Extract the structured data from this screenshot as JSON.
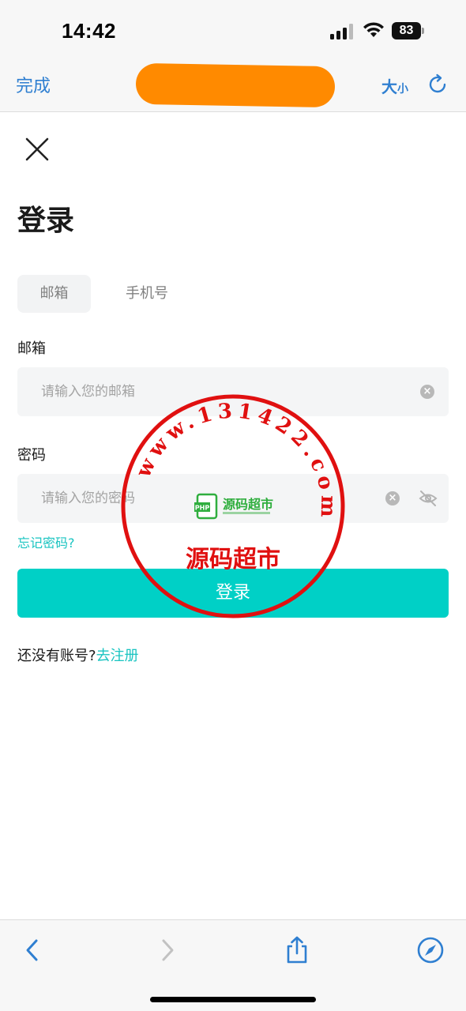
{
  "status": {
    "time": "14:42",
    "battery": "83"
  },
  "nav": {
    "done_label": "完成",
    "font_size_big": "大",
    "font_size_small": "小"
  },
  "page": {
    "title": "登录"
  },
  "tabs": [
    {
      "label": "邮箱",
      "active": true
    },
    {
      "label": "手机号",
      "active": false
    }
  ],
  "form": {
    "email_label": "邮箱",
    "email_placeholder": "请输入您的邮箱",
    "email_value": "",
    "password_label": "密码",
    "password_placeholder": "请输入您的密码",
    "password_value": "",
    "forgot_label": "忘记密码?",
    "submit_label": "登录"
  },
  "register": {
    "prompt": "还没有账号?",
    "link": "去注册"
  },
  "watermark": {
    "ring_text": "www.131422.com",
    "name": "源码超市",
    "badge_text": "PHP",
    "logo_text": "源码超市"
  },
  "colors": {
    "accent": "#00d0c6",
    "link": "#19c4c1",
    "ios_blue": "#2f7fd1",
    "redaction": "#ff8a00",
    "stamp_red": "#e01010"
  },
  "icons": {
    "close": "close-icon",
    "reload": "reload-icon",
    "clear": "clear-icon",
    "password_visibility": "eye-off-icon",
    "back": "chevron-left-icon",
    "forward": "chevron-right-icon",
    "share": "share-icon",
    "browser": "compass-icon"
  }
}
